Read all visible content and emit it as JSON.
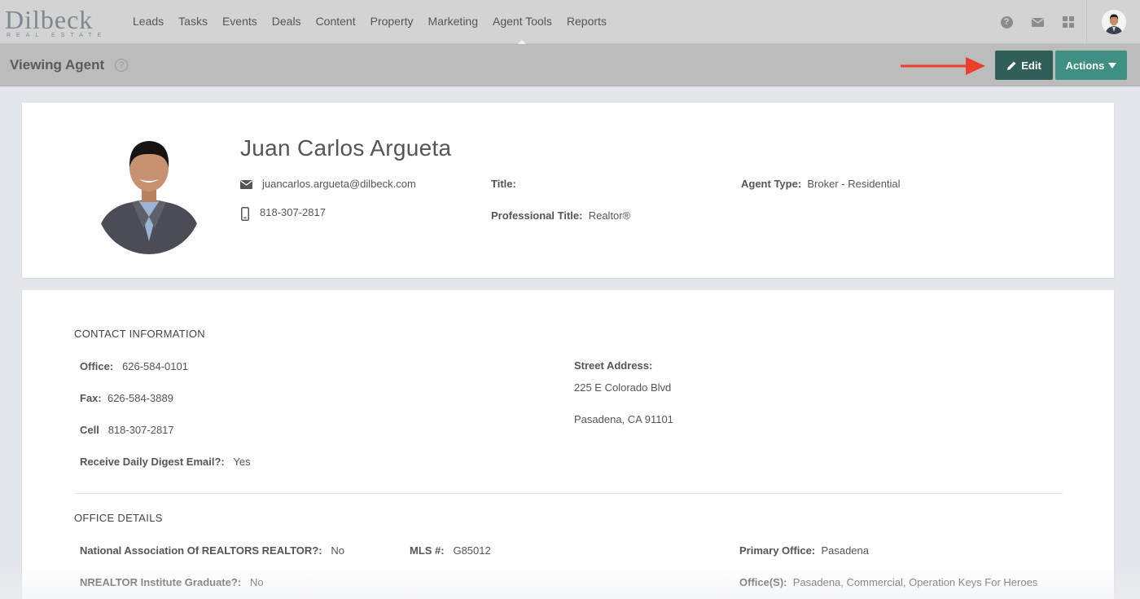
{
  "brand": {
    "name": "Dilbeck",
    "tagline": "REAL ESTATE"
  },
  "nav": {
    "items": [
      {
        "label": "Leads"
      },
      {
        "label": "Tasks"
      },
      {
        "label": "Events"
      },
      {
        "label": "Deals"
      },
      {
        "label": "Content"
      },
      {
        "label": "Property"
      },
      {
        "label": "Marketing"
      },
      {
        "label": "Agent Tools"
      },
      {
        "label": "Reports"
      }
    ],
    "active": "Agent Tools",
    "icons": [
      "help-icon",
      "mail-icon",
      "apps-grid-icon"
    ]
  },
  "subheader": {
    "title": "Viewing Agent",
    "help_glyph": "?",
    "edit_label": "Edit",
    "actions_label": "Actions"
  },
  "agent": {
    "name": "Juan Carlos Argueta",
    "email": "juancarlos.argueta@dilbeck.com",
    "phone": "818-307-2817",
    "title_label": "Title:",
    "title_value": "",
    "professional_title_label": "Professional Title:",
    "professional_title_value": "Realtor®",
    "agent_type_label": "Agent Type:",
    "agent_type_value": "Broker - Residential"
  },
  "contact": {
    "section_title": "CONTACT INFORMATION",
    "office_label": "Office:",
    "office_value": "626-584-0101",
    "fax_label": "Fax:",
    "fax_value": "626-584-3889",
    "cell_label": "Cell",
    "cell_value": "818-307-2817",
    "digest_label": "Receive Daily Digest Email?:",
    "digest_value": "Yes",
    "street_label": "Street Address:",
    "street_line1": "225 E Colorado Blvd",
    "street_line2": "Pasadena, CA 91101"
  },
  "office": {
    "section_title": "OFFICE DETAILS",
    "nar_label": "National Association Of REALTORS REALTOR?:",
    "nar_value": "No",
    "mls_label": "MLS #:",
    "mls_value": "G85012",
    "primary_label": "Primary Office:",
    "primary_value": "Pasadena",
    "institute_label": "NREALTOR Institute Graduate?:",
    "institute_value": "No",
    "offices_label": "Office(S):",
    "offices_value": "Pasadena, Commercial, Operation Keys For Heroes"
  },
  "colors": {
    "edit_button": "#2f5f56",
    "actions_button": "#3f8f82",
    "annotation_arrow": "#e8402a",
    "nav_bg": "#d3d3d3",
    "subheader_bg": "#bcbcbc"
  }
}
